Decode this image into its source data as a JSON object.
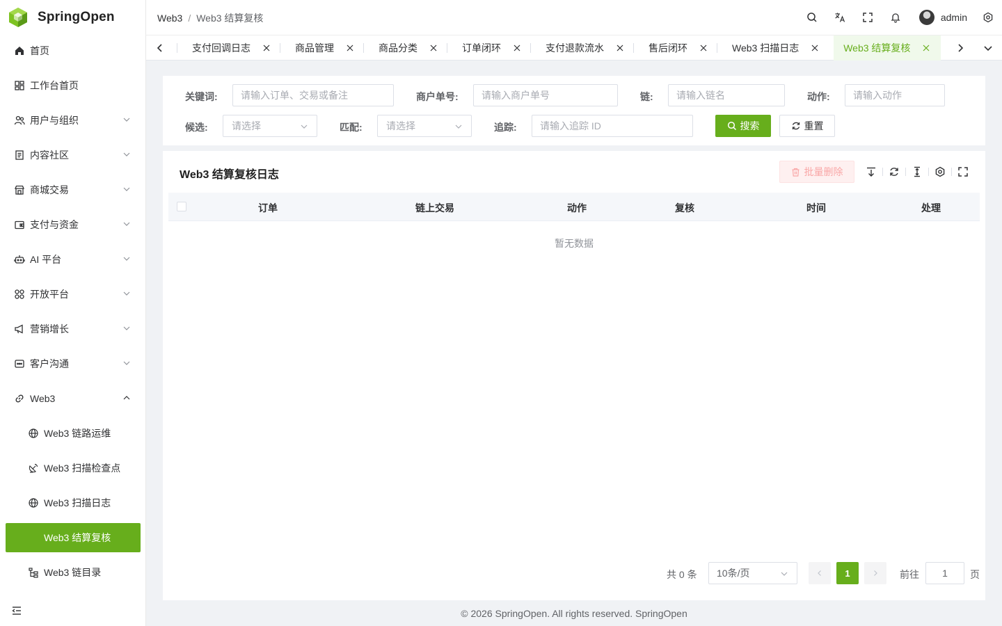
{
  "app": {
    "name": "SpringOpen"
  },
  "sidebar": {
    "items": [
      {
        "label": "首页",
        "icon": "home-icon"
      },
      {
        "label": "工作台首页",
        "icon": "dashboard-icon"
      },
      {
        "label": "用户与组织",
        "icon": "users-icon"
      },
      {
        "label": "内容社区",
        "icon": "document-icon"
      },
      {
        "label": "商城交易",
        "icon": "shop-icon"
      },
      {
        "label": "支付与资金",
        "icon": "wallet-icon"
      },
      {
        "label": "AI 平台",
        "icon": "robot-icon"
      },
      {
        "label": "开放平台",
        "icon": "grid-icon"
      },
      {
        "label": "营销增长",
        "icon": "megaphone-icon"
      },
      {
        "label": "客户沟通",
        "icon": "chat-icon"
      },
      {
        "label": "Web3",
        "icon": "link-icon"
      }
    ],
    "web3_sub": [
      {
        "label": "Web3 链路运维",
        "icon": "globe-icon"
      },
      {
        "label": "Web3 扫描检查点",
        "icon": "satellite-icon"
      },
      {
        "label": "Web3 扫描日志",
        "icon": "globe-icon"
      },
      {
        "label": "Web3 结算复核",
        "icon": "none"
      },
      {
        "label": "Web3 链目录",
        "icon": "tree-icon"
      }
    ]
  },
  "header": {
    "breadcrumb": [
      "Web3",
      "Web3 结算复核"
    ],
    "username": "admin"
  },
  "tabs": [
    "支付回调日志",
    "商品管理",
    "商品分类",
    "订单闭环",
    "支付退款流水",
    "售后闭环",
    "Web3 扫描日志",
    "Web3 结算复核"
  ],
  "search": {
    "keyword_label": "关键词:",
    "keyword_placeholder": "请输入订单、交易或备注",
    "merchant_label": "商户单号:",
    "merchant_placeholder": "请输入商户单号",
    "chain_label": "链:",
    "chain_placeholder": "请输入链名",
    "action_label": "动作:",
    "action_placeholder": "请输入动作",
    "candidate_label": "候选:",
    "candidate_placeholder": "请选择",
    "match_label": "匹配:",
    "match_placeholder": "请选择",
    "trace_label": "追踪:",
    "trace_placeholder": "请输入追踪 ID",
    "search_button": "搜索",
    "reset_button": "重置"
  },
  "table": {
    "title": "Web3 结算复核日志",
    "batch_delete": "批量删除",
    "columns": [
      "订单",
      "链上交易",
      "动作",
      "复核",
      "时间",
      "处理"
    ],
    "empty_text": "暂无数据"
  },
  "pagination": {
    "total_text": "共 0 条",
    "page_size": "10条/页",
    "current_page": "1",
    "goto_label": "前往",
    "goto_value": "1",
    "page_suffix": "页"
  },
  "footer": "© 2026 SpringOpen. All rights reserved. SpringOpen",
  "colors": {
    "accent": "#67ae1c",
    "accent_light": "#f0f9eb",
    "danger_light": "#fef0f0"
  }
}
